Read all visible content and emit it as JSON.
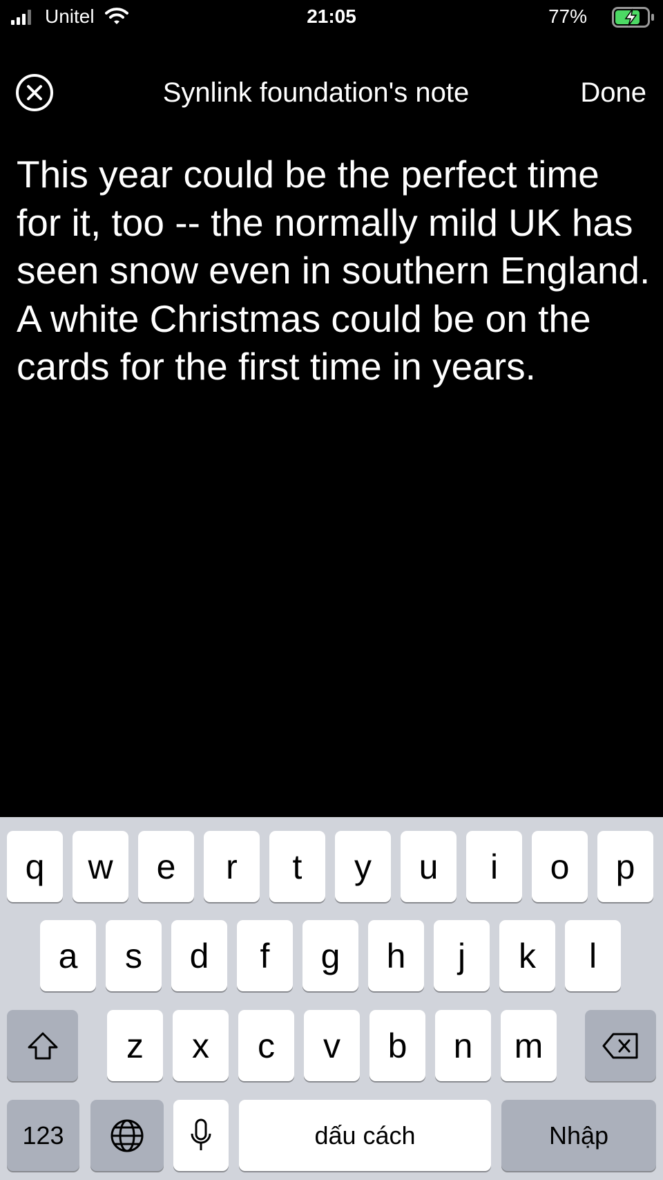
{
  "status_bar": {
    "carrier": "Unitel",
    "time": "21:05",
    "battery_percent": "77%",
    "battery_level": 0.77,
    "icons": [
      "signal-icon",
      "wifi-icon",
      "battery-charging-icon"
    ]
  },
  "header": {
    "title": "Synlink foundation's note",
    "done_label": "Done",
    "close_icon": "close-circle-icon"
  },
  "note": {
    "text": "This year could be the perfect time for it, too -- the normally mild UK has seen snow even in southern England. A white Christmas could be on the cards for the first time in years."
  },
  "keyboard": {
    "row1": [
      "q",
      "w",
      "e",
      "r",
      "t",
      "y",
      "u",
      "i",
      "o",
      "p"
    ],
    "row2": [
      "a",
      "s",
      "d",
      "f",
      "g",
      "h",
      "j",
      "k",
      "l"
    ],
    "row3": [
      "z",
      "x",
      "c",
      "v",
      "b",
      "n",
      "m"
    ],
    "numbers_label": "123",
    "space_label": "dấu cách",
    "return_label": "Nhập",
    "icons": [
      "shift-icon",
      "backspace-icon",
      "globe-icon",
      "microphone-icon"
    ]
  },
  "colors": {
    "background": "#000000",
    "text": "#ffffff",
    "keyboard_bg": "#d1d4db",
    "key_bg": "#ffffff",
    "key_dark_bg": "#abb0bb",
    "battery_green": "#4cd964"
  }
}
